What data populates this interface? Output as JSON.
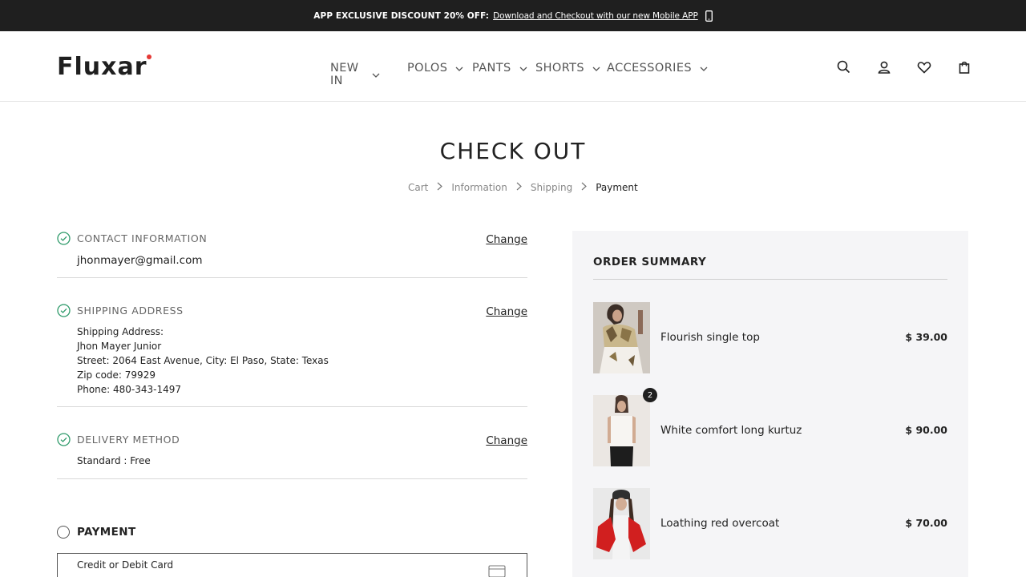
{
  "announcement": {
    "bold_text": "APP EXCLUSIVE DISCOUNT 20% OFF:",
    "link_text": "Download and Checkout with our new Mobile APP",
    "icon": "smartphone-icon"
  },
  "header": {
    "logo": "Fluxar",
    "nav": [
      {
        "label": "NEW IN"
      },
      {
        "label": "POLOS"
      },
      {
        "label": "PANTS"
      },
      {
        "label": "SHORTS"
      },
      {
        "label": "ACCESSORIES"
      }
    ],
    "icons": [
      "search-icon",
      "account-icon",
      "wishlist-icon",
      "bag-icon"
    ]
  },
  "page": {
    "title": "CHECK OUT",
    "breadcrumb": [
      "Cart",
      "Information",
      "Shipping",
      "Payment"
    ]
  },
  "contact": {
    "title": "CONTACT INFORMATION",
    "change": "Change",
    "email": "jhonmayer@gmail.com"
  },
  "shipping": {
    "title": "SHIPPING ADDRESS",
    "change": "Change",
    "lines": [
      "Shipping Address:",
      "Jhon Mayer Junior",
      "Street: 2064 East Avenue, City: El Paso, State: Texas",
      "Zip code: 79929",
      "Phone: 480-343-1497"
    ]
  },
  "delivery": {
    "title": "DELIVERY METHOD",
    "change": "Change",
    "method": "Standard : Free"
  },
  "payment": {
    "title": "PAYMENT",
    "option": "Credit or Debit Card"
  },
  "summary": {
    "title": "ORDER SUMMARY",
    "items": [
      {
        "name": "Flourish single top",
        "price": "$ 39.00",
        "qty": ""
      },
      {
        "name": "White comfort long kurtuz",
        "price": "$ 90.00",
        "qty": "2"
      },
      {
        "name": "Loathing red overcoat",
        "price": "$ 70.00",
        "qty": ""
      }
    ]
  },
  "colors": {
    "topbar_bg": "#1f1f1f",
    "check_green": "#2e9a6a",
    "summary_bg": "#f5f5f7",
    "logo_dot": "#e53935"
  }
}
